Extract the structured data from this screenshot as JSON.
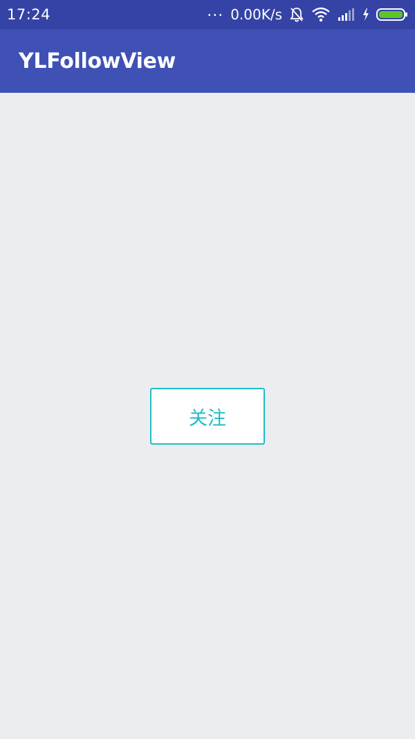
{
  "status_bar": {
    "time": "17:24",
    "dots": "...",
    "net_speed": "0.00K/s",
    "icons": [
      "bell-off-icon",
      "wifi-icon",
      "signal-icon",
      "charging-icon",
      "battery-icon"
    ],
    "battery_color": "#5ec424"
  },
  "app_bar": {
    "title": "YLFollowView",
    "color": "#3f51b5"
  },
  "main": {
    "follow_button_label": "关注",
    "accent_color": "#1fbcc6"
  }
}
